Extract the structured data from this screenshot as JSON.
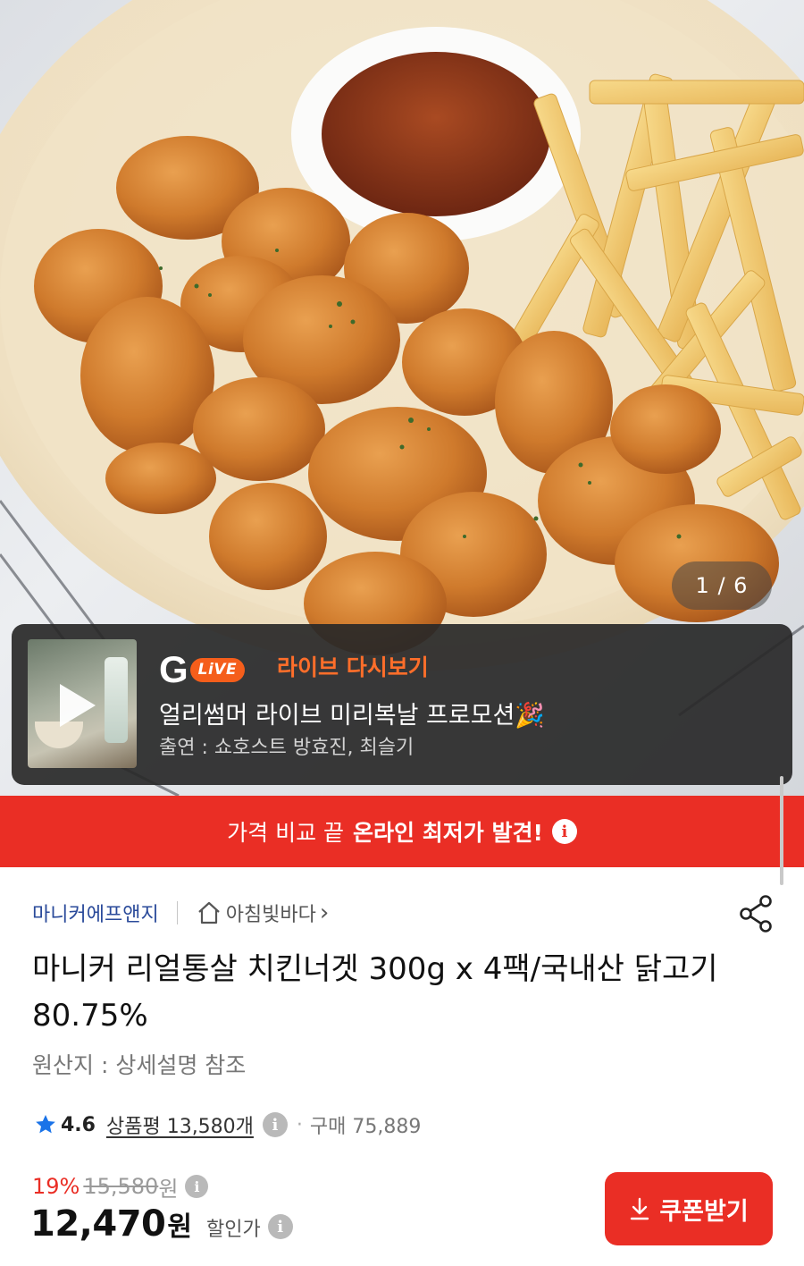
{
  "gallery": {
    "counter": "1 / 6"
  },
  "live": {
    "logo_letter": "G",
    "logo_badge": "LiVE",
    "tag": "라이브 다시보기",
    "title": "얼리썸머 라이브 미리복날 프로모션🎉",
    "cast": "출연 : 쇼호스트 방효진, 최슬기"
  },
  "promo": {
    "text": "가격 비교 끝",
    "strong": "온라인 최저가 발견!",
    "info_icon": "i"
  },
  "seller": {
    "name": "마니커에프앤지",
    "store": "아침빛바다",
    "store_chevron": "›"
  },
  "product": {
    "title": "마니커 리얼통살 치킨너겟 300g x 4팩/국내산 닭고기 80.75%",
    "origin": "원산지 : 상세설명 참조"
  },
  "rating": {
    "score": "4.6",
    "reviews": "상품평 13,580개",
    "info_icon": "i",
    "dot": "·",
    "purchases": "구매 75,889"
  },
  "price": {
    "discount_rate": "19%",
    "original": "15,580",
    "original_unit": "원",
    "info_icon": "i",
    "sale": "12,470",
    "sale_unit": "원",
    "sale_label": "할인가"
  },
  "coupon": {
    "label": "쿠폰받기"
  },
  "colors": {
    "accent_red": "#ea2e25",
    "live_orange": "#f55e1b",
    "seller_blue": "#2a4a9a",
    "star_blue": "#1a73e8"
  }
}
